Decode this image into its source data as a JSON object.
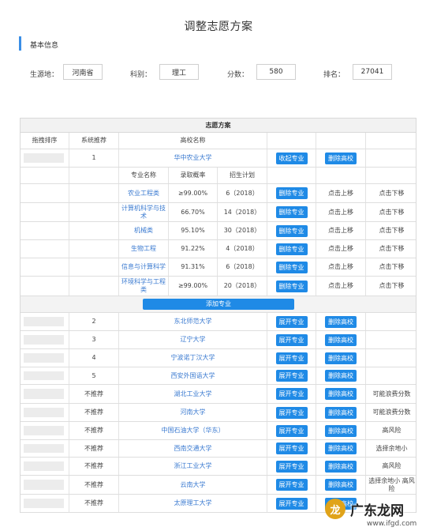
{
  "page": {
    "title": "调整志愿方案"
  },
  "basic": {
    "section_title": "基本信息",
    "origin_label": "生源地：",
    "origin_value": "河南省",
    "subject_label": "科别：",
    "subject_value": "理工",
    "score_label": "分数：",
    "score_value": "580",
    "rank_label": "排名：",
    "rank_value": "27041"
  },
  "plan": {
    "title": "志愿方案",
    "headers": [
      "拖拽排序",
      "系统推荐",
      "高校名称"
    ],
    "expanded": {
      "order": "1",
      "school": "华中农业大学",
      "collapse_btn": "收起专业",
      "delete_school_btn": "删除高校",
      "major_headers": [
        "专业名称",
        "录取概率",
        "招生计划"
      ],
      "majors": [
        {
          "name": "农业工程类",
          "prob": "≥99.00%",
          "plan": "6（2018）"
        },
        {
          "name": "计算机科学与技术",
          "prob": "66.70%",
          "plan": "14（2018）"
        },
        {
          "name": "机械类",
          "prob": "95.10%",
          "plan": "30（2018）"
        },
        {
          "name": "生物工程",
          "prob": "91.22%",
          "plan": "4（2018）"
        },
        {
          "name": "信息与计算科学",
          "prob": "91.31%",
          "plan": "6（2018）"
        },
        {
          "name": "环境科学与工程类",
          "prob": "≥99.00%",
          "plan": "20（2018）"
        }
      ],
      "delete_major_btn": "删除专业",
      "move_up": "点击上移",
      "move_down": "点击下移",
      "add_major_btn": "添加专业"
    },
    "expand_btn": "展开专业",
    "delete_school_btn": "删除高校",
    "schools": [
      {
        "rec": "2",
        "name": "东北师范大学",
        "note": ""
      },
      {
        "rec": "3",
        "name": "辽宁大学",
        "note": ""
      },
      {
        "rec": "4",
        "name": "宁波诺丁汉大学",
        "note": ""
      },
      {
        "rec": "5",
        "name": "西安外国语大学",
        "note": ""
      },
      {
        "rec": "不推荐",
        "name": "湖北工业大学",
        "note": "可能浪费分数"
      },
      {
        "rec": "不推荐",
        "name": "河南大学",
        "note": "可能浪费分数"
      },
      {
        "rec": "不推荐",
        "name": "中国石油大学（华东）",
        "note": "高风险"
      },
      {
        "rec": "不推荐",
        "name": "西南交通大学",
        "note": "选择余地小"
      },
      {
        "rec": "不推荐",
        "name": "浙江工业大学",
        "note": "高风险"
      },
      {
        "rec": "不推荐",
        "name": "云南大学",
        "note": "选择余地小 高风险"
      },
      {
        "rec": "不推荐",
        "name": "太原理工大学",
        "note": ""
      }
    ]
  },
  "watermark": {
    "text": "广东龙网",
    "logo": "龙",
    "sub": "www.ifgd.com"
  }
}
